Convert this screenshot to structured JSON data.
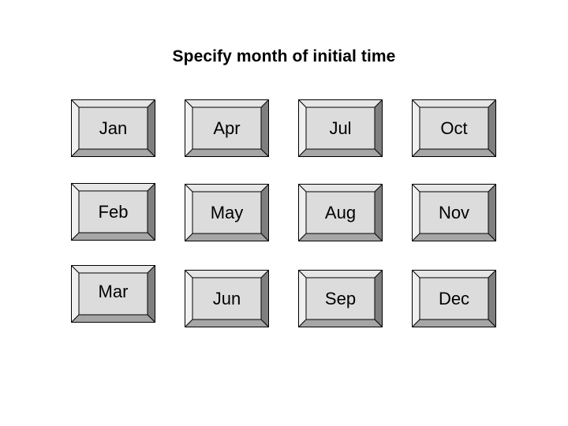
{
  "dialog": {
    "title": "Specify month of initial time"
  },
  "months": [
    {
      "label": "Jan"
    },
    {
      "label": "Feb"
    },
    {
      "label": "Mar"
    },
    {
      "label": "Apr"
    },
    {
      "label": "May"
    },
    {
      "label": "Jun"
    },
    {
      "label": "Jul"
    },
    {
      "label": "Aug"
    },
    {
      "label": "Sep"
    },
    {
      "label": "Oct"
    },
    {
      "label": "Nov"
    },
    {
      "label": "Dec"
    }
  ],
  "colors": {
    "face": "#dcdcdc",
    "bevel_left": "#f0f0f0",
    "bevel_top": "#e6e6e6",
    "bevel_right": "#7f7f7f",
    "bevel_bottom": "#a6a6a6"
  }
}
